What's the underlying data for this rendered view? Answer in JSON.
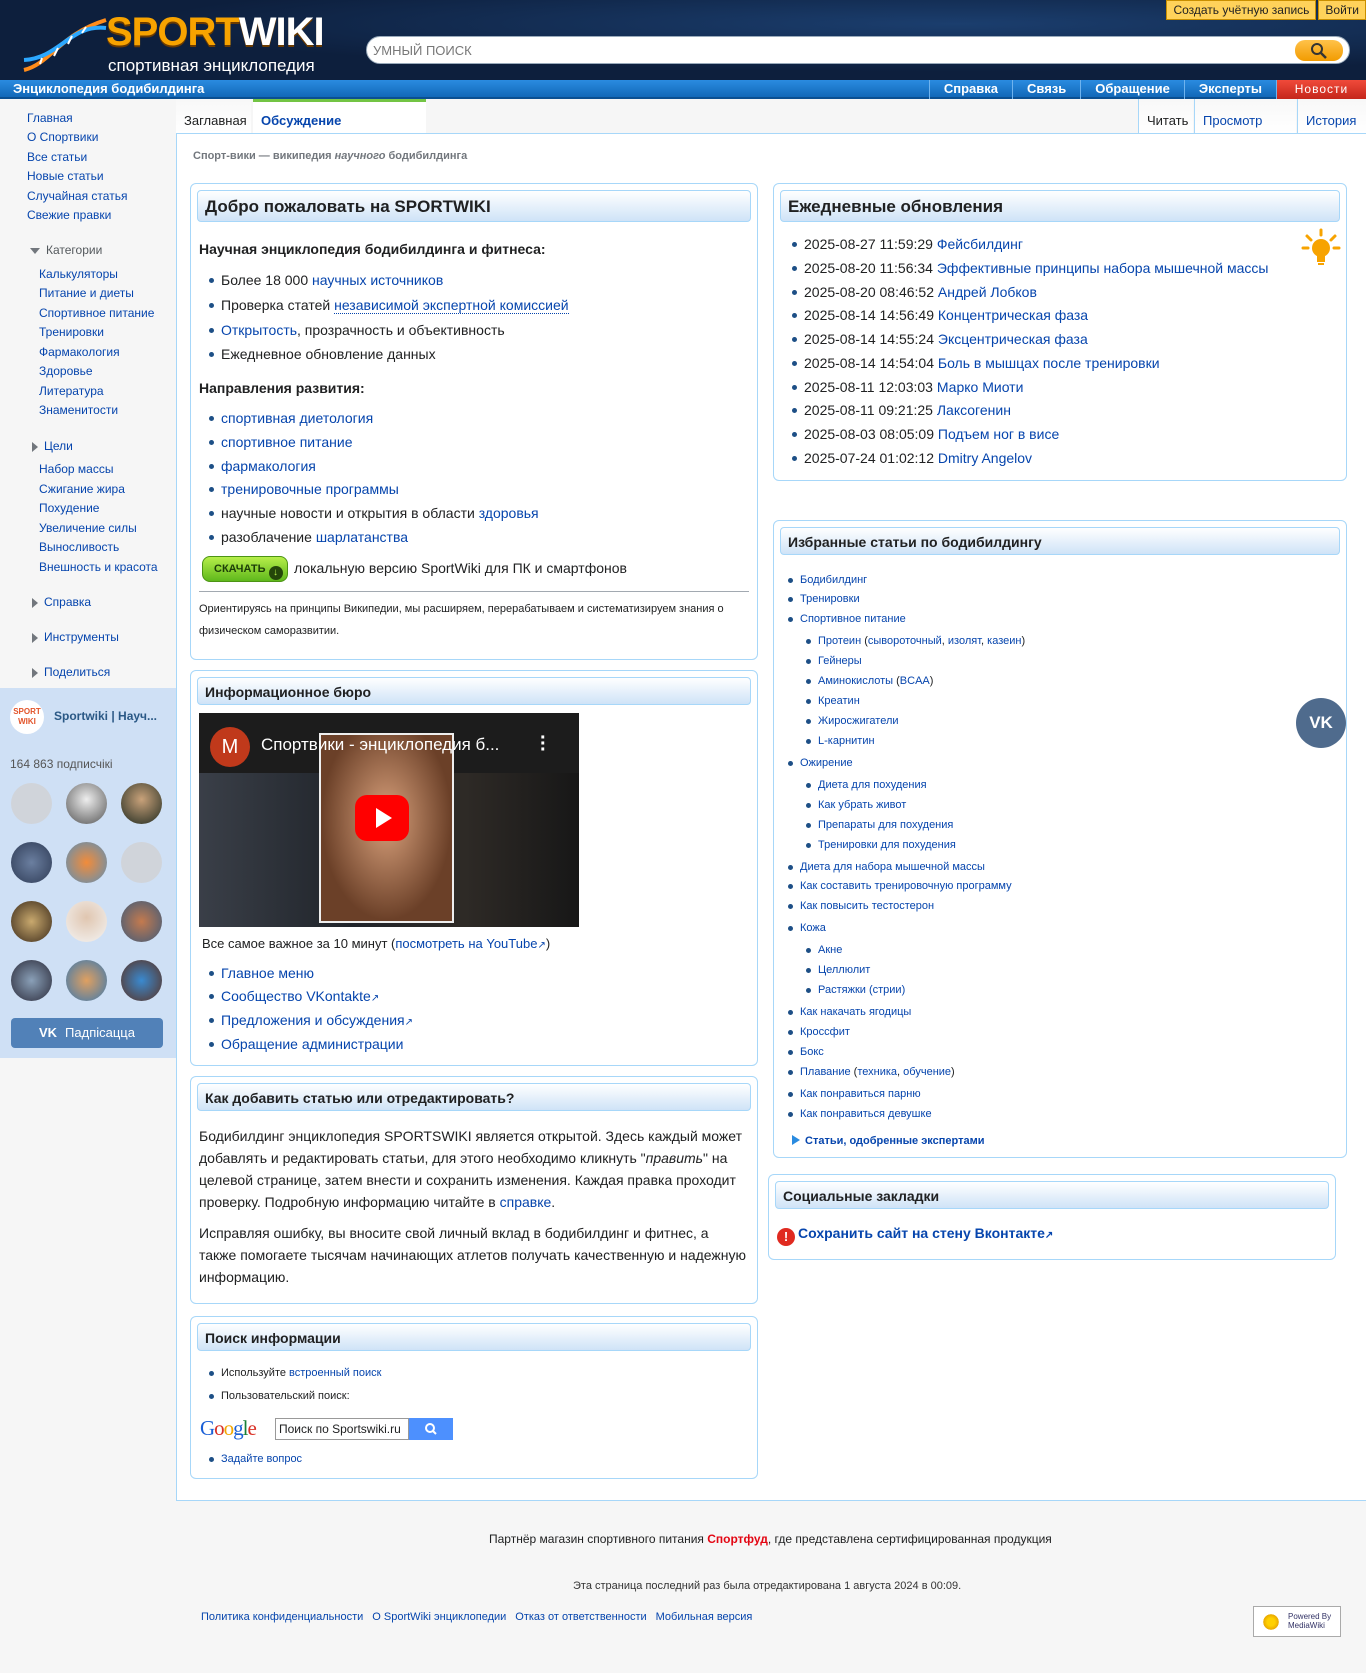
{
  "header": {
    "logo_word": "SPORT",
    "logo_word2": "WIKI",
    "logo_sub": "спортивная энциклопедия",
    "search_placeholder": "УМНЫЙ ПОИСК",
    "create_account": "Создать учётную запись",
    "login": "Войти"
  },
  "navbar": {
    "title": "Энциклопедия бодибилдинга",
    "tabs": [
      "Справка",
      "Связь",
      "Обращение",
      "Эксперты"
    ],
    "news": "Новости"
  },
  "sidebar": {
    "main": [
      "Главная",
      "О Спортвики",
      "Все статьи",
      "Новые статьи",
      "Случайная статья",
      "Свежие правки"
    ],
    "categories_title": "Категории",
    "categories": [
      "Калькуляторы",
      "Питание и диеты",
      "Спортивное питание",
      "Тренировки",
      "Фармакология",
      "Здоровье",
      "Литература",
      "Знаменитости"
    ],
    "goals_title": "Цели",
    "goals": [
      "Набор массы",
      "Сжигание жира",
      "Похудение",
      "Увеличение силы",
      "Выносливость",
      "Внешность и красота"
    ],
    "help": "Справка",
    "tools": "Инструменты",
    "share": "Поделиться"
  },
  "vk": {
    "avatar_text": "SPORT WIKI",
    "name": "Sportwiki | Науч...",
    "subscribers": "164 863 подписчікі",
    "subscribe": "Падпісацца"
  },
  "page_tabs": {
    "main": "Заглавная",
    "talk": "Обсуждение",
    "read": "Читать",
    "view_source": "Просмотр кода",
    "history": "История"
  },
  "tagline": {
    "part1": "Спорт-вики — википедия ",
    "part2": "научного",
    "part3": " бодибилдинга"
  },
  "welcome": {
    "title": "Добро пожаловать на SPORTWIKI",
    "subtitle": "Научная энциклопедия бодибилдинга и фитнеса:",
    "items": [
      {
        "pre": "Более 18 000 ",
        "link": "научных источников",
        "post": ""
      },
      {
        "pre": "Проверка статей ",
        "link": "независимой экспертной комиссией",
        "post": ""
      },
      {
        "pre": "",
        "link": "Открытость",
        "post": ", прозрачность и объективность"
      },
      {
        "pre": "Ежедневное обновление данных",
        "link": "",
        "post": ""
      }
    ],
    "directions_title": "Направления развития:",
    "directions": [
      {
        "pre": "",
        "link": "спортивная диетология"
      },
      {
        "pre": "",
        "link": "спортивное питание"
      },
      {
        "pre": "",
        "link": "фармакология"
      },
      {
        "pre": "",
        "link": "тренировочные программы"
      },
      {
        "pre": "научные новости и открытия в области ",
        "link": "здоровья"
      },
      {
        "pre": "разоблачение ",
        "link": "шарлатанства"
      }
    ],
    "download_btn": "СКАЧАТЬ",
    "download_text": "локальную версию SportWiki для ПК и смартфонов",
    "note": "Ориентируясь на принципы Википедии, мы расширяем, перерабатываем и систематизируем знания о физическом саморазвитии."
  },
  "info": {
    "title": "Информационное бюро",
    "video_title": "Спортвики - энциклопедия б...",
    "video_letter": "M",
    "caption_pre": "Все самое важное за 10 минут (",
    "caption_link": "посмотреть на YouTube",
    "caption_post": ")",
    "links": [
      "Главное меню",
      "Сообщество VKontakte",
      "Предложения и обсуждения",
      "Обращение администрации"
    ]
  },
  "howto": {
    "title": "Как добавить статью или отредактировать?",
    "p1_a": "Бодибилдинг энциклопедия SPORTSWIKI является открытой. Здесь каждый может добавлять и редактировать статьи, для этого необходимо кликнуть \"",
    "p1_em": "править",
    "p1_b": "\" на целевой странице, затем внести и сохранить изменения. Каждая правка проходит проверку. Подробную информацию читайте в ",
    "p1_link": "справке",
    "p1_c": ".",
    "p2": "Исправляя ошибку, вы вносите свой личный вклад в бодибилдинг и фитнес, а также помогаете тысячам начинающих атлетов получать качественную и надежную информацию."
  },
  "searchbox": {
    "title": "Поиск информации",
    "item1_pre": "Используйте ",
    "item1_link": "встроенный поиск",
    "item2": "Пользовательский поиск:",
    "google_value": "Поиск по Sportswiki.ru",
    "ask": "Задайте вопрос"
  },
  "daily": {
    "title": "Ежедневные обновления",
    "items": [
      {
        "date": "2025-08-27 11:59:29",
        "link": "Фейсбилдинг"
      },
      {
        "date": "2025-08-20 11:56:34",
        "link": "Эффективные принципы набора мышечной массы"
      },
      {
        "date": "2025-08-20 08:46:52",
        "link": "Андрей Лобков"
      },
      {
        "date": "2025-08-14 14:56:49",
        "link": "Концентрическая фаза"
      },
      {
        "date": "2025-08-14 14:55:24",
        "link": "Эксцентрическая фаза"
      },
      {
        "date": "2025-08-14 14:54:04",
        "link": "Боль в мышцах после тренировки"
      },
      {
        "date": "2025-08-11 12:03:03",
        "link": "Марко Миоти"
      },
      {
        "date": "2025-08-11 09:21:25",
        "link": "Лаксогенин"
      },
      {
        "date": "2025-08-03 08:05:09",
        "link": "Подъем ног в висе"
      },
      {
        "date": "2025-07-24 01:02:12",
        "link": "Dmitry Angelov"
      }
    ]
  },
  "featured": {
    "title": "Избранные статьи по бодибилдингу",
    "l1": "Бодибилдинг",
    "l2": "Тренировки",
    "l3": "Спортивное питание",
    "protein": "Протеин",
    "protein_open": " (",
    "whey": "сывороточный",
    "comma": ", ",
    "isolate": "изолят",
    "casein": "казеин",
    "close": ")",
    "gainers": "Гейнеры",
    "amino": "Аминокислоты",
    "bcaa": "BCAA",
    "creatine": "Креатин",
    "burners": "Жиросжигатели",
    "carnitine": "L-карнитин",
    "obesity": "Ожирение",
    "diet": "Диета для похудения",
    "belly": "Как убрать живот",
    "drugs": "Препараты для похудения",
    "training": "Тренировки для похудения",
    "massdiet": "Диета для набора мышечной массы",
    "program": "Как составить тренировочную программу",
    "testo": "Как повысить тестостерон",
    "skin": "Кожа",
    "acne": "Акне",
    "cellulite": "Целлюлит",
    "stretch": "Растяжки (стрии)",
    "glutes": "Как накачать ягодицы",
    "crossfit": "Кроссфит",
    "boxing": "Бокс",
    "swim": "Плавание",
    "technique": "техника",
    "learning": "обучение",
    "guy": "Как понравиться парню",
    "girl": "Как понравиться девушке",
    "expert": "Статьи, одобренные экспертами"
  },
  "social": {
    "title": "Социальные закладки",
    "link": "Сохранить сайт на стену Вконтакте"
  },
  "footer": {
    "partner_pre": "Партнёр магазин спортивного питания ",
    "partner_link": "Спортфуд",
    "partner_post": ", где представлена сертифицированная продукция",
    "edited": "Эта страница последний раз была отредактирована 1 августа 2024 в 00:09.",
    "links": [
      "Политика конфиденциальности",
      "О SportWiki энциклопедии",
      "Отказ от ответственности",
      "Мобильная версия"
    ],
    "powered": "Powered By MediaWiki"
  },
  "colors": {
    "brand_orange": "#f7a300",
    "link": "#0645ad",
    "nav_blue": "#1a7ad0",
    "accent_red": "#e30613"
  }
}
